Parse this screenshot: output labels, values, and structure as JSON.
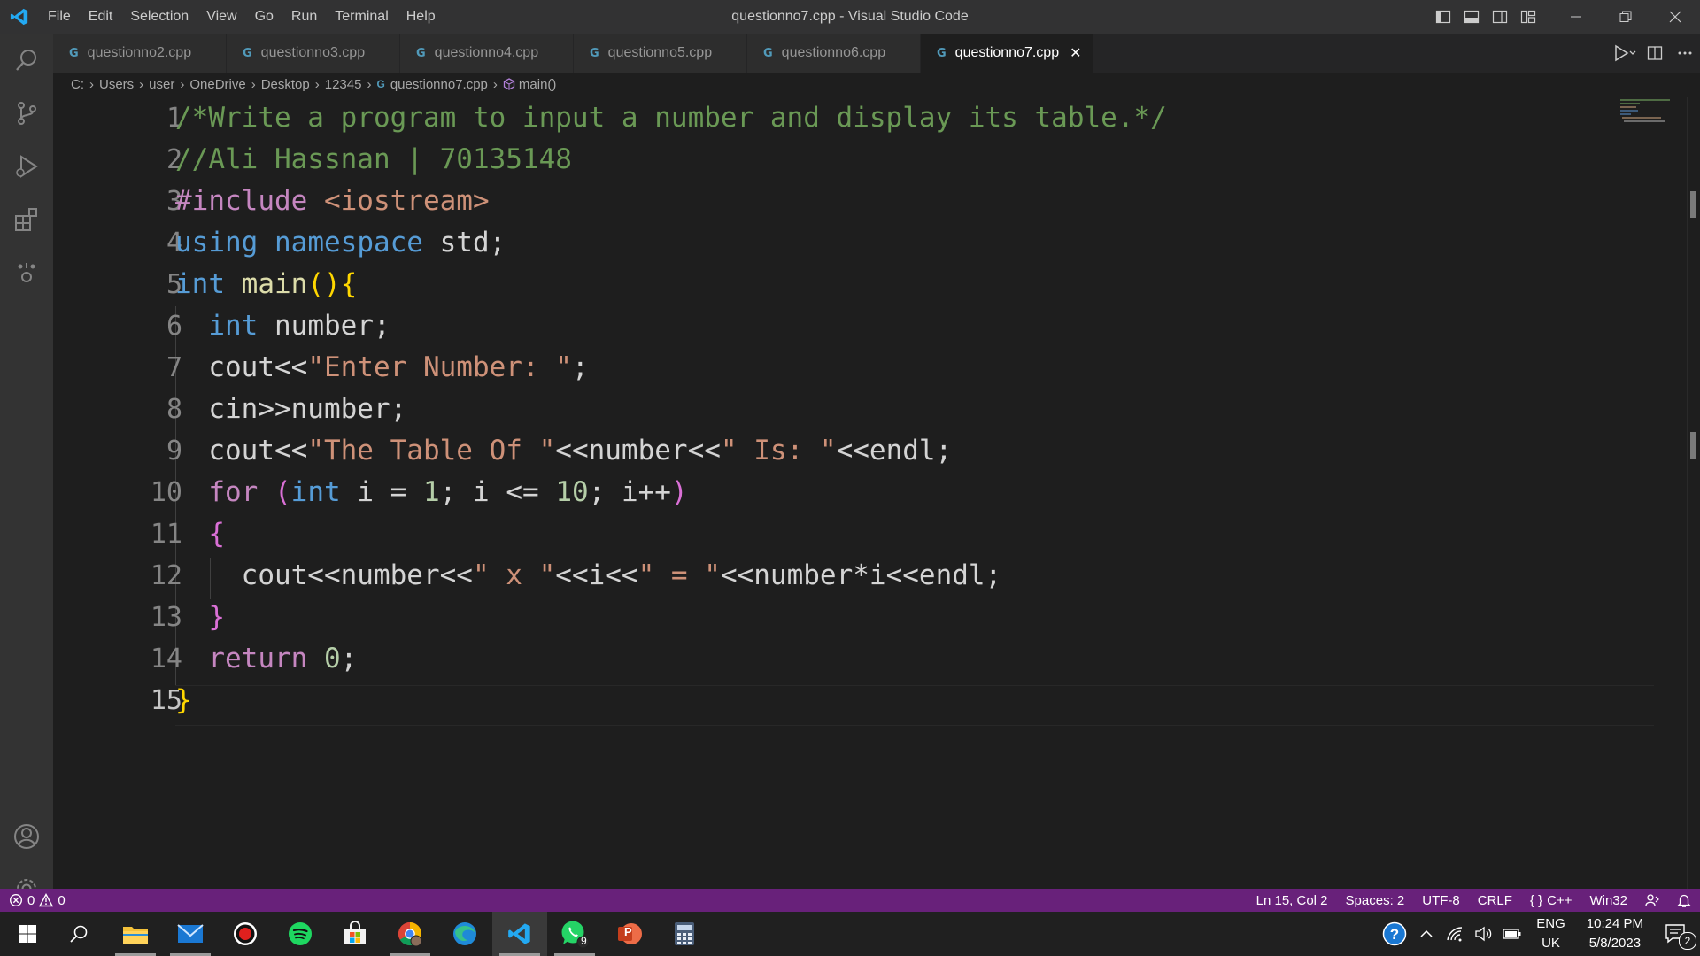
{
  "window": {
    "title": "questionno7.cpp - Visual Studio Code"
  },
  "menu": [
    "File",
    "Edit",
    "Selection",
    "View",
    "Go",
    "Run",
    "Terminal",
    "Help"
  ],
  "tabs": [
    {
      "label": "questionno2.cpp",
      "icon": "C-plus-plus-file-icon",
      "active": false
    },
    {
      "label": "questionno3.cpp",
      "icon": "C-plus-plus-file-icon",
      "active": false
    },
    {
      "label": "questionno4.cpp",
      "icon": "C-plus-plus-file-icon",
      "active": false
    },
    {
      "label": "questionno5.cpp",
      "icon": "C-plus-plus-file-icon",
      "active": false
    },
    {
      "label": "questionno6.cpp",
      "icon": "C-plus-plus-file-icon",
      "active": false
    },
    {
      "label": "questionno7.cpp",
      "icon": "C-plus-plus-file-icon",
      "active": true
    }
  ],
  "tab_icon_glyph": "G",
  "close_glyph": "✕",
  "breadcrumb": [
    "C:",
    "Users",
    "user",
    "OneDrive",
    "Desktop",
    "12345",
    "questionno7.cpp",
    "main()"
  ],
  "breadcrumb_sep": "›",
  "code_lines": [
    "/*Write a program to input a number and display its table.*/",
    "//Ali Hassnan | 70135148",
    "#include <iostream>",
    "using namespace std;",
    "int main(){",
    "  int number;",
    "  cout<<\"Enter Number: \";",
    "  cin>>number;",
    "  cout<<\"The Table Of \"<<number<<\" Is: \"<<endl;",
    "  for (int i = 1; i <= 10; i++)",
    "  {",
    "    cout<<number<<\" x \"<<i<<\" = \"<<number*i<<endl;",
    "  }",
    "  return 0;",
    "}"
  ],
  "line_numbers": [
    "1",
    "2",
    "3",
    "4",
    "5",
    "6",
    "7",
    "8",
    "9",
    "10",
    "11",
    "12",
    "13",
    "14",
    "15"
  ],
  "status": {
    "errors": "0",
    "warnings": "0",
    "position": "Ln 15, Col 2",
    "spaces": "Spaces: 2",
    "encoding": "UTF-8",
    "eol": "CRLF",
    "language": "C++",
    "language_prefix": "{ }",
    "platform": "Win32"
  },
  "taskbar": {
    "language": "ENG",
    "region": "UK",
    "time": "10:24 PM",
    "date": "5/8/2023",
    "whatsapp_badge": "9",
    "notifications_badge": "2",
    "powerpoint_letter": "P"
  },
  "colors": {
    "statusbar": "#68217a",
    "titlebar": "#323233",
    "activitybar": "#333333",
    "editor_bg": "#1e1e1e",
    "taskbar": "#202020"
  }
}
